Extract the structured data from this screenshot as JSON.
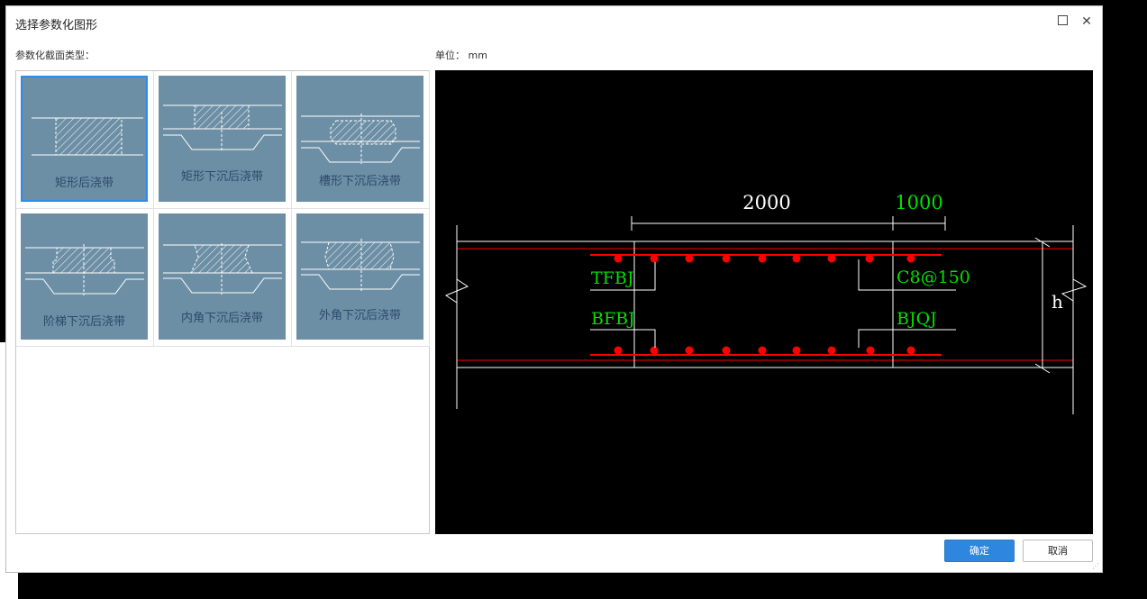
{
  "dialog": {
    "title": "选择参数化图形",
    "section_label": "参数化截面类型：",
    "unit_label": "单位：  mm",
    "ok_label": "确定",
    "cancel_label": "取消"
  },
  "thumbnails": [
    {
      "caption": "矩形后浇带",
      "selected": true
    },
    {
      "caption": "矩形下沉后浇带",
      "selected": false
    },
    {
      "caption": "槽形下沉后浇带",
      "selected": false
    },
    {
      "caption": "阶梯下沉后浇带",
      "selected": false
    },
    {
      "caption": "内角下沉后浇带",
      "selected": false
    },
    {
      "caption": "外角下沉后浇带",
      "selected": false
    }
  ],
  "preview": {
    "dim_main": "2000",
    "dim_side": "1000",
    "label_tfbj": "TFBJ",
    "label_bfbj": "BFBJ",
    "label_c8": "C8@150",
    "label_bjqj": "BJQJ",
    "label_h": "h"
  },
  "colors": {
    "accent": "#2f86df",
    "thumb_bg": "#6d8fa6",
    "cad_red": "#ff0000",
    "cad_green": "#00e000"
  }
}
